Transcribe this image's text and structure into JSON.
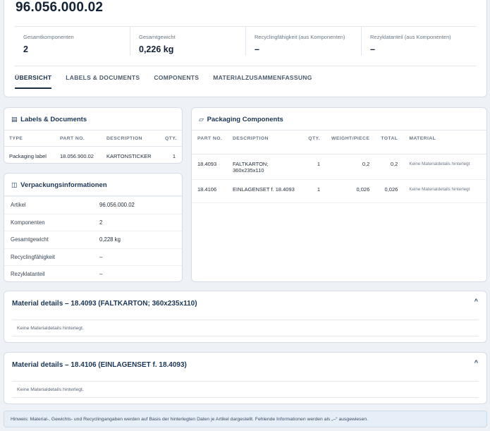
{
  "article": {
    "title": "96.056.000.02",
    "stats": [
      {
        "label": "Gesamtkomponenten",
        "value": "2"
      },
      {
        "label": "Gesamtgewicht",
        "value": "0,226 kg"
      },
      {
        "label": "Recyclingfähigkeit (aus Komponenten)",
        "value": "–"
      },
      {
        "label": "Rezyklatanteil (aus Komponenten)",
        "value": "–"
      }
    ],
    "tabs": [
      "ÜBERSICHT",
      "LABELS & DOCUMENTS",
      "COMPONENTS",
      "MATERIALZUSAMMENFASSUNG"
    ],
    "active_tab": "ÜBERSICHT"
  },
  "labels": {
    "title": "Labels & Documents",
    "icon": "document-icon",
    "columns": [
      "TYPE",
      "PART NO.",
      "DESCRIPTION",
      "QTY."
    ],
    "rows": [
      {
        "type": "Packaging label",
        "part_no": "18.056.900.02",
        "description": "KARTONSTICKER",
        "qty": "1"
      }
    ]
  },
  "info": {
    "title": "Verpackungsinformationen",
    "icon": "columns-icon",
    "rows": [
      {
        "key": "Artikel",
        "value": "96.056.000.02"
      },
      {
        "key": "Komponenten",
        "value": "2"
      },
      {
        "key": "Gesamtgewicht",
        "value": "0,228 kg"
      },
      {
        "key": "Recyclingfähigkeit",
        "value": "–"
      },
      {
        "key": "Rezyklatanteil",
        "value": "–"
      }
    ]
  },
  "components": {
    "title": "Packaging Components",
    "icon": "box-icon",
    "columns": [
      "PART NO.",
      "DESCRIPTION",
      "QTY.",
      "WEIGHT/PIECE",
      "TOTAL",
      "MATERIAL"
    ],
    "rows": [
      {
        "part_no": "18.4093",
        "description": "FALTKARTON; 360x235x110",
        "qty": "1",
        "weight": "0,2",
        "total": "0,2",
        "material": "Keine Materialdetails hinterlegt"
      },
      {
        "part_no": "18.4106",
        "description": "EINLAGENSET f. 18.4093",
        "qty": "1",
        "weight": "0,026",
        "total": "0,026",
        "material": "Keine Materialdetails hinterlegt"
      }
    ]
  },
  "materials": [
    {
      "title": "Material details – 18.4093 (FALTKARTON; 360x235x110)",
      "body": "Keine Materialdetails hinterlegt.",
      "toggle": "^"
    },
    {
      "title": "Material details – 18.4106 (EINLAGENSET f. 18.4093)",
      "body": "Keine Materialdetails hinterlegt.",
      "toggle": "^"
    }
  ],
  "hint": "Hinweis: Material-, Gewichts- und Recyclingangaben werden auf Basis der hinterlegten Daten je Artikel dargestellt. Fehlende Informationen werden als „–“ ausgewiesen."
}
